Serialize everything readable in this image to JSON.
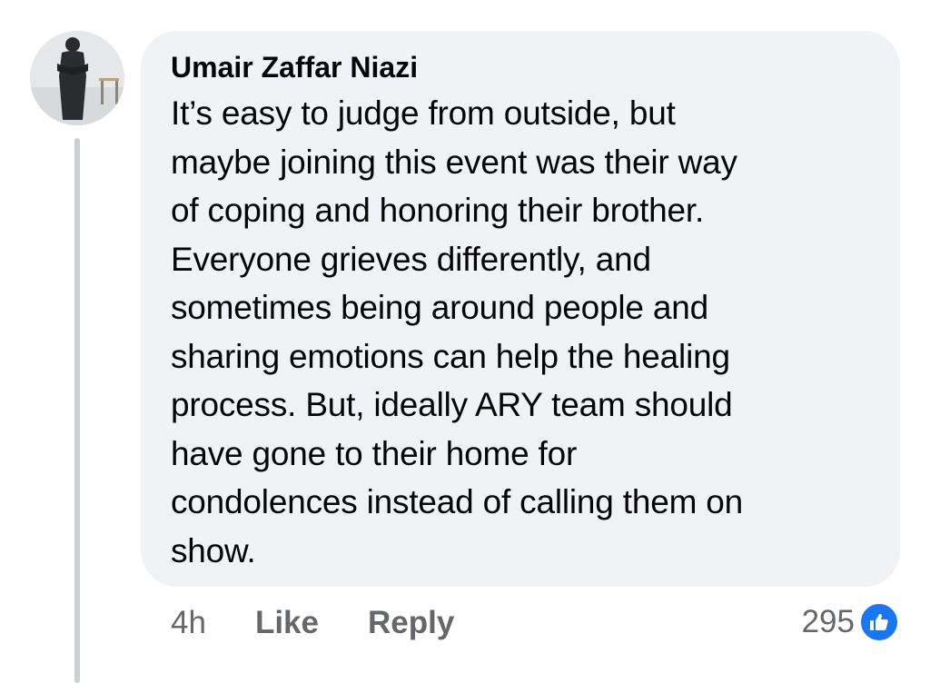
{
  "comment": {
    "author": "Umair Zaffar Niazi",
    "avatar_icon": "profile-photo",
    "lines": [
      "It’s easy to judge from outside, but",
      "maybe joining this event was their way",
      "of coping and honoring their brother.",
      "Everyone grieves differently, and",
      "sometimes being around people and",
      "sharing emotions can help the healing",
      "process. But, ideally ARY team should",
      "have gone to their home for",
      "condolences instead of calling them on",
      "show."
    ]
  },
  "actions": {
    "time": "4h",
    "like_label": "Like",
    "reply_label": "Reply"
  },
  "reactions": {
    "count": "295",
    "icon": "thumbs-up-icon",
    "color": "#1877f2"
  },
  "colors": {
    "bubble": "#f0f2f5",
    "muted_text": "#65676b",
    "thread_line": "#ccd0d6"
  }
}
